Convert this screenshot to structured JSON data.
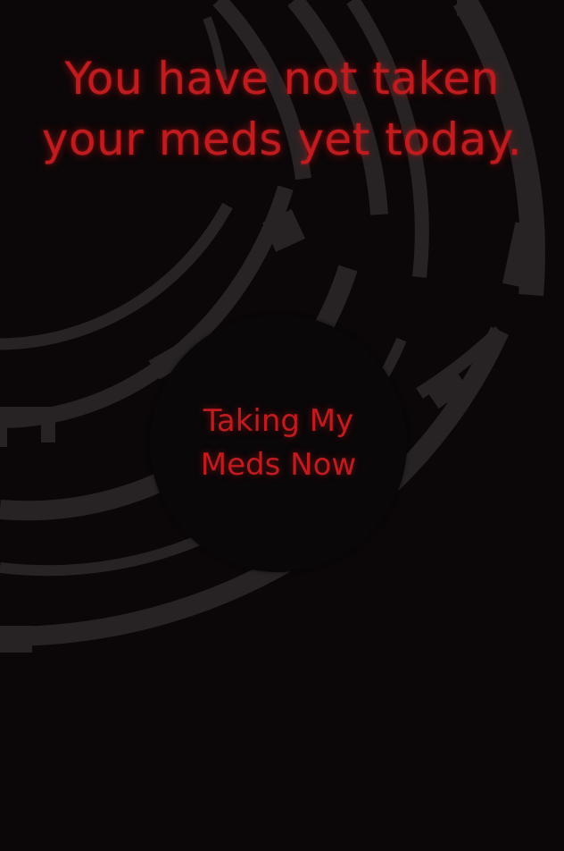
{
  "reminder": {
    "headline_line1": "You have not taken",
    "headline_line2": "your meds yet today."
  },
  "action_button": {
    "label_line1": "Taking My",
    "label_line2": "Meds Now"
  },
  "colors": {
    "background": "#0b0708",
    "accent_red": "#c01b1f",
    "ring_gray": "#2a2627",
    "button_fill": "#0a0708"
  }
}
